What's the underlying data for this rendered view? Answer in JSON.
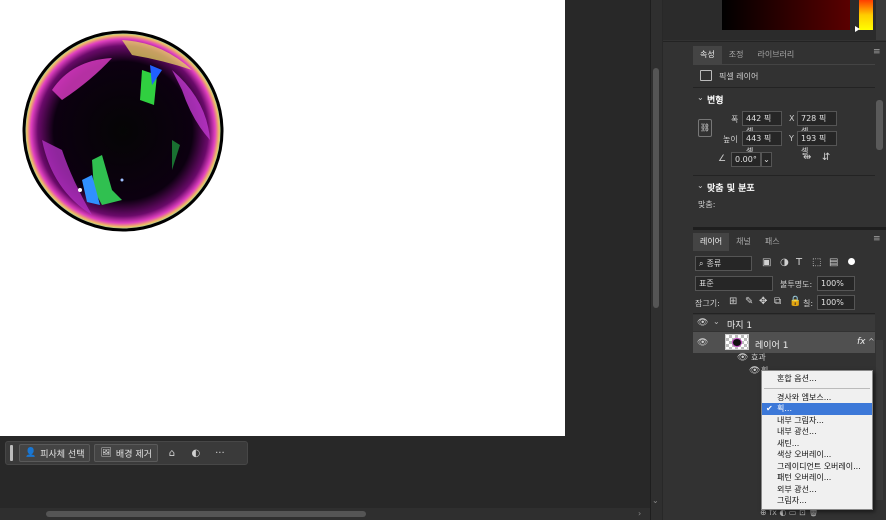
{
  "taskbar": {
    "select_subject": "피사체 선택",
    "remove_background": "배경 제거",
    "more": "···"
  },
  "properties_panel": {
    "tabs": [
      "속성",
      "조정",
      "라이브러리"
    ],
    "active_tab": "속성",
    "type_label": "픽셀 레이어",
    "transform": {
      "title": "변형",
      "width_label": "폭",
      "width_value": "442 픽셀",
      "height_label": "높이",
      "height_value": "443 픽셀",
      "x_label": "X",
      "x_value": "728 픽셀",
      "y_label": "Y",
      "y_value": "193 픽셀",
      "angle_value": "0.00°"
    },
    "align": {
      "title": "맞춤 및 분포",
      "label": "맞춤:"
    }
  },
  "layers_panel": {
    "tabs": [
      "레이어",
      "채널",
      "패스"
    ],
    "active_tab": "레이어",
    "filter_kind": "종류",
    "blend_mode": "표준",
    "opacity_label": "불투명도:",
    "opacity_value": "100%",
    "lock_label": "잠그기:",
    "fill_label": "칠:",
    "fill_value": "100%",
    "group_name": "마지 1",
    "layer_name": "레이어 1",
    "fx_label": "fx",
    "effects_label": "효과",
    "stroke_label": "획"
  },
  "context_menu": {
    "items": [
      {
        "label": "혼합 옵션...",
        "checked": false,
        "selected": false
      },
      {
        "label": "경사와 엠보스...",
        "checked": false,
        "selected": false
      },
      {
        "label": "획...",
        "checked": true,
        "selected": true
      },
      {
        "label": "내부 그림자...",
        "checked": false,
        "selected": false
      },
      {
        "label": "내부 광선...",
        "checked": false,
        "selected": false
      },
      {
        "label": "새틴...",
        "checked": false,
        "selected": false
      },
      {
        "label": "색상 오버레이...",
        "checked": false,
        "selected": false
      },
      {
        "label": "그레이디언트 오버레이...",
        "checked": false,
        "selected": false
      },
      {
        "label": "패턴 오버레이...",
        "checked": false,
        "selected": false
      },
      {
        "label": "외부 광선...",
        "checked": false,
        "selected": false
      },
      {
        "label": "그림자...",
        "checked": false,
        "selected": false
      }
    ]
  },
  "colors": {
    "accent": "#3c78d8",
    "panel_bg": "#323232",
    "canvas_bg": "#ffffff"
  }
}
